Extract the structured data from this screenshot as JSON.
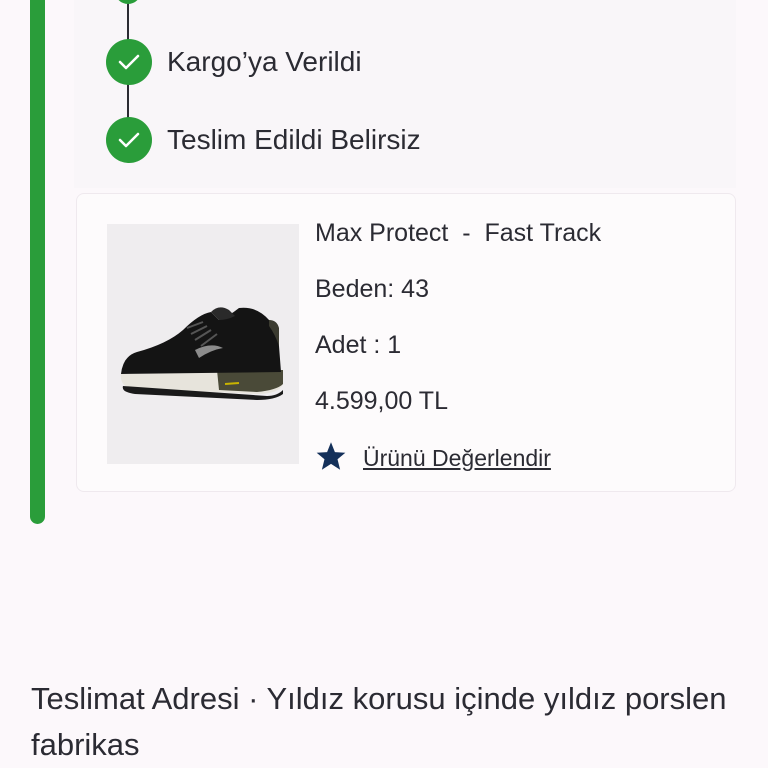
{
  "timeline": {
    "steps": [
      {
        "label": "Kargo’ya Verildi",
        "status": "done"
      },
      {
        "label": "Teslim Edildi Belirsiz",
        "status": "done"
      }
    ]
  },
  "product": {
    "name": "Max Protect  -  Fast Track",
    "size": "Beden: 43",
    "quantity": "Adet : 1",
    "price": "4.599,00 TL",
    "rate_label": "Ürünü Değerlendir",
    "image_icon": "sneaker-image"
  },
  "address": {
    "text": "Teslimat Adresi · Yıldız korusu içinde yıldız porslen fabrikas"
  },
  "colors": {
    "accent_green": "#2a9d3a",
    "star_navy": "#14305a",
    "text": "#2b2b33"
  }
}
